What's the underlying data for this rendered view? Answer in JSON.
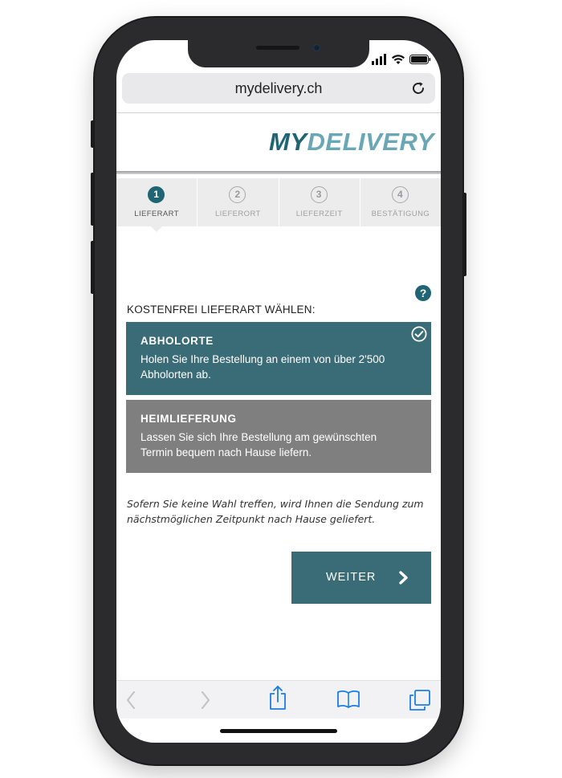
{
  "browser": {
    "url": "mydelivery.ch"
  },
  "header": {
    "logo_part1": "MY",
    "logo_part2": "DELIVERY"
  },
  "steps": [
    {
      "number": "1",
      "label": "LIEFERART",
      "active": true
    },
    {
      "number": "2",
      "label": "LIEFERORT",
      "active": false
    },
    {
      "number": "3",
      "label": "LIEFERZEIT",
      "active": false
    },
    {
      "number": "4",
      "label": "BESTÄTIGUNG",
      "active": false
    }
  ],
  "help": {
    "symbol": "?"
  },
  "section": {
    "label": "KOSTENFREI LIEFERART WÄHLEN:"
  },
  "options": [
    {
      "title": "ABHOLORTE",
      "description": "Holen Sie Ihre Bestellung an einem von über 2'500 Abholorten ab.",
      "selected": true
    },
    {
      "title": "HEIMLIEFERUNG",
      "description": "Lassen Sie sich Ihre Bestellung am gewünschten Termin bequem nach Hause liefern.",
      "selected": false
    }
  ],
  "note": {
    "text": "Sofern Sie keine Wahl treffen, wird Ihnen die Sendung zum nächstmöglichen Zeitpunkt nach Hause geliefert."
  },
  "actions": {
    "next_label": "WEITER"
  },
  "colors": {
    "accent": "#3a6c77",
    "accent_dark": "#1f6573",
    "logo_light": "#6aa7b6",
    "unselected": "#7f7f80",
    "ios_blue": "#1a7ee6"
  },
  "icons": {
    "reload": "reload-icon",
    "check": "check-circle-icon",
    "next": "chevron-right-icon",
    "back": "chevron-left-icon",
    "forward": "chevron-right-icon",
    "share": "share-icon",
    "bookmarks": "book-icon",
    "tabs": "tabs-icon"
  }
}
